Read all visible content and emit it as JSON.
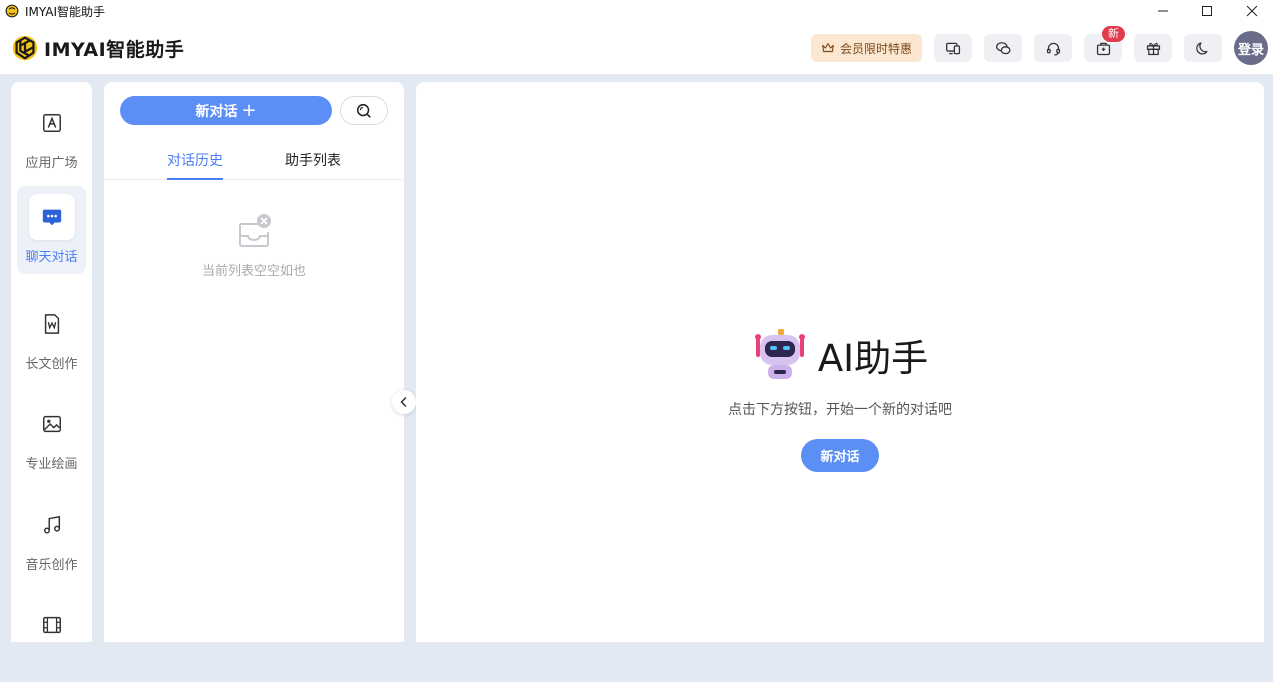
{
  "window": {
    "title": "IMYAI智能助手"
  },
  "header": {
    "brand": "IMYAI智能助手",
    "vip_label": "会员限时特惠",
    "new_badge": "新",
    "login_label": "登录"
  },
  "nav": {
    "items": [
      {
        "label": "应用广场",
        "icon": "app-square-icon"
      },
      {
        "label": "聊天对话",
        "icon": "chat-icon",
        "active": true
      },
      {
        "label": "长文创作",
        "icon": "word-doc-icon"
      },
      {
        "label": "专业绘画",
        "icon": "image-icon"
      },
      {
        "label": "音乐创作",
        "icon": "music-icon"
      },
      {
        "label": "",
        "icon": "video-icon"
      }
    ]
  },
  "sidebar": {
    "new_chat_label": "新对话",
    "new_chat_plus": "+",
    "tabs": [
      {
        "label": "对话历史",
        "active": true
      },
      {
        "label": "助手列表",
        "active": false
      }
    ],
    "empty_text": "当前列表空空如也"
  },
  "main": {
    "title": "AI助手",
    "subtitle": "点击下方按钮，开始一个新的对话吧",
    "new_chat_label": "新对话"
  },
  "colors": {
    "accent": "#5b8ff5",
    "active_text": "#4a7cf6",
    "vip_bg": "#fbe6cf",
    "badge": "#e23b4d"
  }
}
